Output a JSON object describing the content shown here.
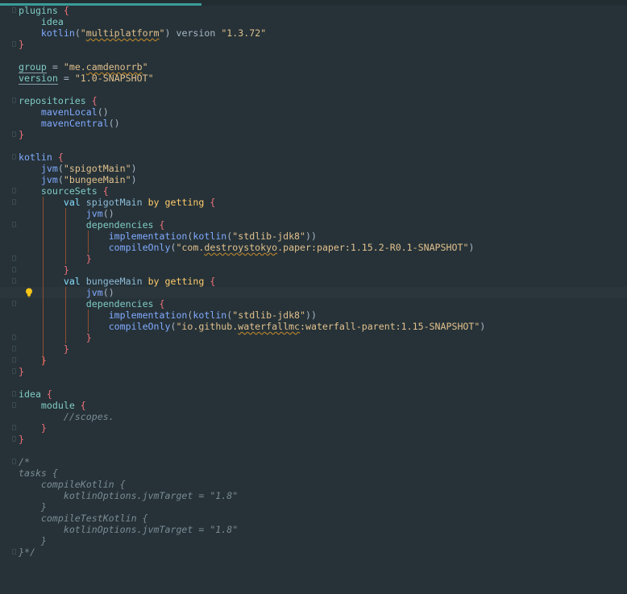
{
  "editor": {
    "language": "kotlin",
    "lines": [
      [
        "plugins",
        " ",
        "{"
      ],
      [
        "    ",
        "idea"
      ],
      [
        "    ",
        "kotlin",
        "(",
        "\"multiplatform\"",
        ")",
        " version ",
        "\"1.3.72\""
      ],
      [
        "}"
      ],
      [
        ""
      ],
      [
        "group",
        " = ",
        "\"me.camdenorrb\""
      ],
      [
        "version",
        " = ",
        "\"1.0-SNAPSHOT\""
      ],
      [
        ""
      ],
      [
        "repositories",
        " ",
        "{"
      ],
      [
        "    ",
        "mavenLocal",
        "()"
      ],
      [
        "    ",
        "mavenCentral",
        "()"
      ],
      [
        "}"
      ],
      [
        ""
      ],
      [
        "kotlin",
        " ",
        "{"
      ],
      [
        "    ",
        "jvm",
        "(",
        "\"spigotMain\"",
        ")"
      ],
      [
        "    ",
        "jvm",
        "(",
        "\"bungeeMain\"",
        ")"
      ],
      [
        "    ",
        "sourceSets",
        " ",
        "{"
      ],
      [
        "        ",
        "val",
        " ",
        "spigotMain",
        " ",
        "by",
        " ",
        "getting",
        " ",
        "{"
      ],
      [
        "            ",
        "jvm",
        "()"
      ],
      [
        "            ",
        "dependencies",
        " ",
        "{"
      ],
      [
        "                ",
        "implementation",
        "(",
        "kotlin",
        "(",
        "\"stdlib-jdk8\"",
        "))"
      ],
      [
        "                ",
        "compileOnly",
        "(",
        "\"com.destroystokyo.paper:paper:1.15.2-R0.1-SNAPSHOT\"",
        ")"
      ],
      [
        "            ",
        "}"
      ],
      [
        "        ",
        "}"
      ],
      [
        "        ",
        "val",
        " ",
        "bungeeMain",
        " ",
        "by",
        " ",
        "getting",
        " ",
        "{"
      ],
      [
        "            ",
        "jvm",
        "()"
      ],
      [
        "            ",
        "dependencies",
        " ",
        "{"
      ],
      [
        "                ",
        "implementation",
        "(",
        "kotlin",
        "(",
        "\"stdlib-jdk8\"",
        "))"
      ],
      [
        "                ",
        "compileOnly",
        "(",
        "\"io.github.waterfallmc:waterfall-parent:1.15-SNAPSHOT\"",
        ")"
      ],
      [
        "            ",
        "}"
      ],
      [
        "        ",
        "}"
      ],
      [
        "    ",
        "}"
      ],
      [
        "}"
      ],
      [
        ""
      ],
      [
        "idea",
        " ",
        "{"
      ],
      [
        "    ",
        "module",
        " ",
        "{"
      ],
      [
        "        ",
        "//scopes."
      ],
      [
        "    ",
        "}"
      ],
      [
        "}"
      ],
      [
        ""
      ],
      [
        "/*"
      ],
      [
        "tasks {"
      ],
      [
        "    compileKotlin {"
      ],
      [
        "        kotlinOptions.jvmTarget = \"1.8\""
      ],
      [
        "    }"
      ],
      [
        "    compileTestKotlin {"
      ],
      [
        "        kotlinOptions.jvmTarget = \"1.8\""
      ],
      [
        "    }"
      ],
      [
        "}*/"
      ],
      [
        ""
      ]
    ]
  },
  "icons": {
    "bulb": "lightbulb-icon",
    "fold": "fold-marker-icon"
  },
  "colors": {
    "background": "#263238",
    "string": "#e2c08d",
    "brace": "#f07178",
    "guide": "#a3512f",
    "comment": "#7b8b93",
    "progress": "#3a9c97"
  }
}
